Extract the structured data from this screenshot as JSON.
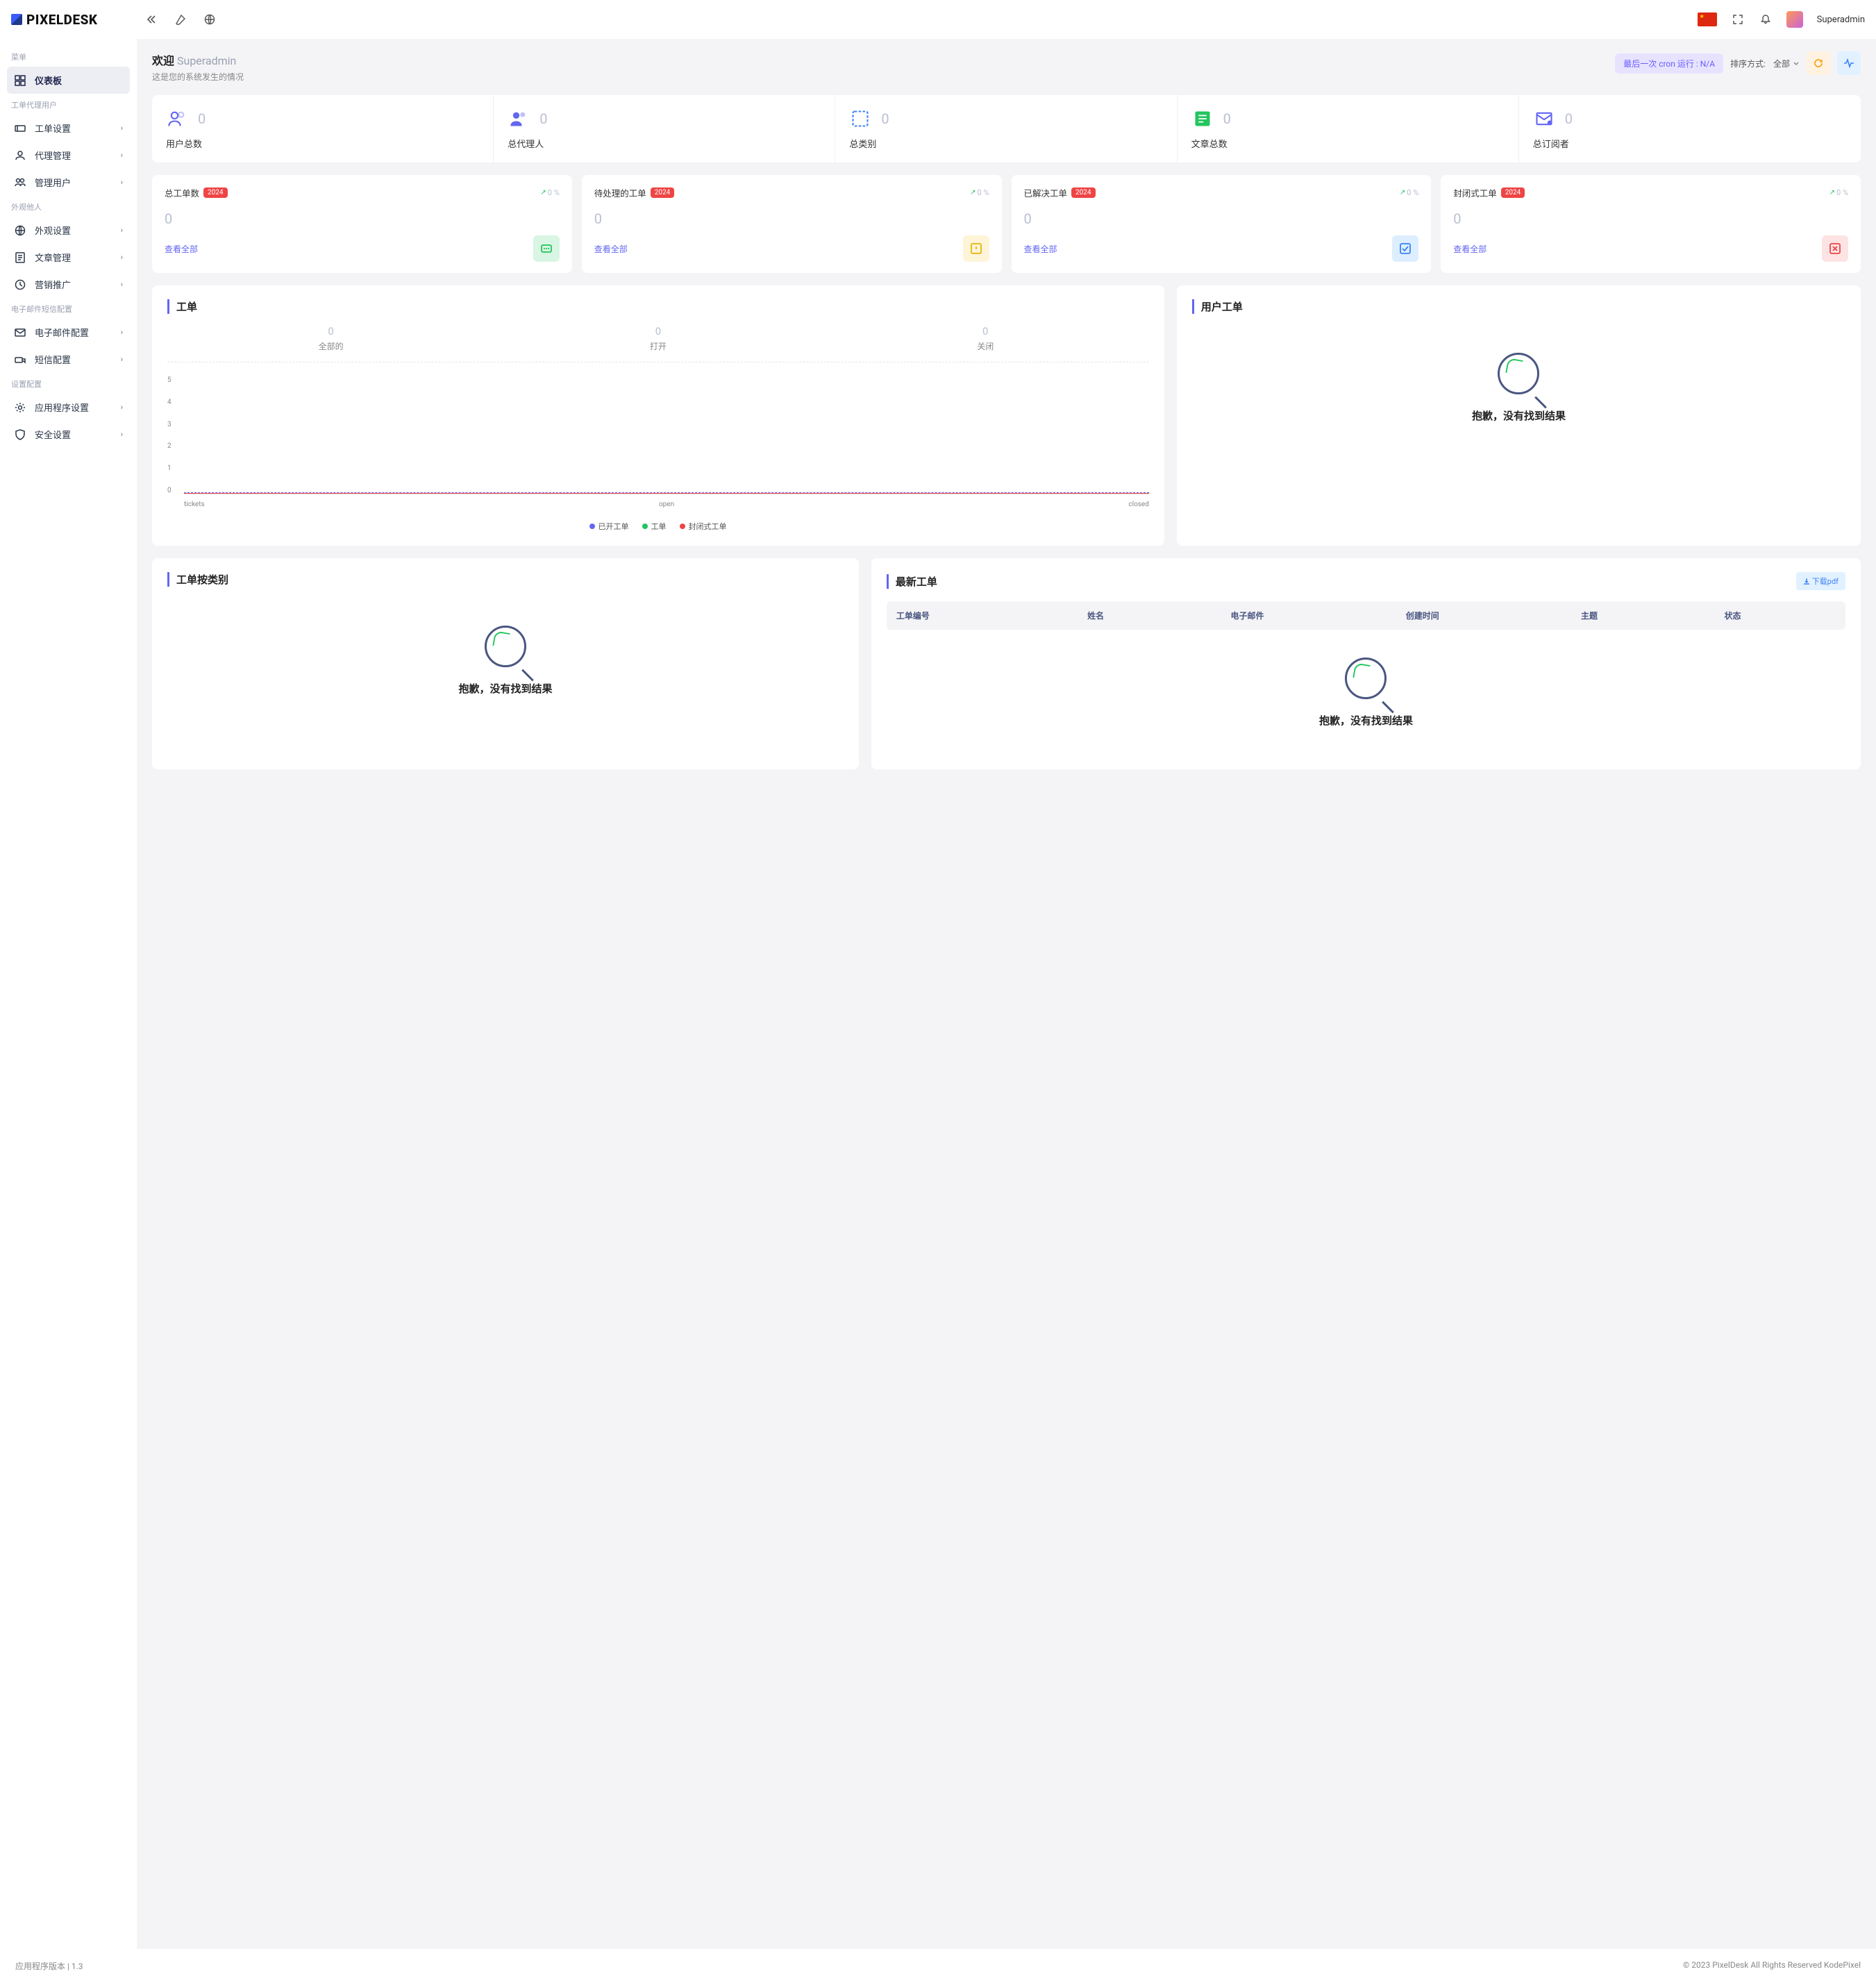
{
  "brand": "PIXELDESK",
  "topbar_user": "Superadmin",
  "sidebar": {
    "sections": [
      {
        "label": "菜单",
        "items": [
          {
            "icon": "dashboard",
            "label": "仪表板",
            "active": true,
            "chev": false
          }
        ]
      },
      {
        "label": "工单代理用户",
        "items": [
          {
            "icon": "ticket",
            "label": "工单设置",
            "chev": true
          },
          {
            "icon": "agent",
            "label": "代理管理",
            "chev": true
          },
          {
            "icon": "users",
            "label": "管理用户",
            "chev": true
          }
        ]
      },
      {
        "label": "外观他人",
        "items": [
          {
            "icon": "globe",
            "label": "外观设置",
            "chev": true
          },
          {
            "icon": "article",
            "label": "文章管理",
            "chev": true
          },
          {
            "icon": "promo",
            "label": "营销推广",
            "chev": true
          }
        ]
      },
      {
        "label": "电子邮件短信配置",
        "items": [
          {
            "icon": "mail",
            "label": "电子邮件配置",
            "chev": true
          },
          {
            "icon": "sms",
            "label": "短信配置",
            "chev": true
          }
        ]
      },
      {
        "label": "设置配置",
        "items": [
          {
            "icon": "gear",
            "label": "应用程序设置",
            "chev": true
          },
          {
            "icon": "shield",
            "label": "安全设置",
            "chev": true
          }
        ]
      }
    ]
  },
  "header": {
    "welcome": "欢迎",
    "username": "Superadmin",
    "subtitle": "这是您的系统发生的情况",
    "cron": "最后一次 cron 运行 : N/A",
    "sort_label": "排序方式:",
    "sort_value": "全部"
  },
  "stats5": [
    {
      "value": "0",
      "label": "用户总数",
      "color": "#6366f1"
    },
    {
      "value": "0",
      "label": "总代理人",
      "color": "#6366f1"
    },
    {
      "value": "0",
      "label": "总类别",
      "color": "#3b82f6"
    },
    {
      "value": "0",
      "label": "文章总数",
      "color": "#22c55e"
    },
    {
      "value": "0",
      "label": "总订阅者",
      "color": "#6366f1"
    }
  ],
  "cards4": [
    {
      "title": "总工单数",
      "year": "2024",
      "pct": "0 %",
      "value": "0",
      "link": "查看全部",
      "iconClass": "ci-green"
    },
    {
      "title": "待处理的工单",
      "year": "2024",
      "pct": "0 %",
      "value": "0",
      "link": "查看全部",
      "iconClass": "ci-yellow"
    },
    {
      "title": "已解决工单",
      "year": "2024",
      "pct": "0 %",
      "value": "0",
      "link": "查看全部",
      "iconClass": "ci-blue"
    },
    {
      "title": "封闭式工单",
      "year": "2024",
      "pct": "0 %",
      "value": "0",
      "link": "查看全部",
      "iconClass": "ci-red"
    }
  ],
  "panel_tickets": {
    "title": "工单",
    "tabs": [
      {
        "value": "0",
        "label": "全部的"
      },
      {
        "value": "0",
        "label": "打开"
      },
      {
        "value": "0",
        "label": "关闭"
      }
    ],
    "legend": [
      {
        "color": "#6366f1",
        "label": "已开工单"
      },
      {
        "color": "#22c55e",
        "label": "工单"
      },
      {
        "color": "#ef4444",
        "label": "封闭式工单"
      }
    ]
  },
  "panel_user_tickets": {
    "title": "用户工单",
    "empty": "抱歉，没有找到结果"
  },
  "panel_by_cat": {
    "title": "工单按类别",
    "empty": "抱歉，没有找到结果"
  },
  "panel_latest": {
    "title": "最新工单",
    "download": "下载pdf",
    "columns": [
      "工单编号",
      "姓名",
      "电子邮件",
      "创建时间",
      "主题",
      "状态"
    ],
    "empty": "抱歉，没有找到结果"
  },
  "chart_data": {
    "type": "line",
    "categories": [
      "tickets",
      "open",
      "closed"
    ],
    "series": [
      {
        "name": "已开工单",
        "values": [
          0,
          0,
          0
        ],
        "color": "#6366f1"
      },
      {
        "name": "工单",
        "values": [
          0,
          0,
          0
        ],
        "color": "#22c55e"
      },
      {
        "name": "封闭式工单",
        "values": [
          0,
          0,
          0
        ],
        "color": "#ef4444"
      }
    ],
    "ylim": [
      0,
      5
    ],
    "yticks": [
      0,
      1,
      2,
      3,
      4,
      5
    ],
    "xlabel": "",
    "ylabel": "",
    "title": ""
  },
  "footer": {
    "left_prefix": "应用程序版本 | ",
    "version": "1.3",
    "right": "© 2023 PixelDesk All Rights Reserved KodePixel"
  }
}
